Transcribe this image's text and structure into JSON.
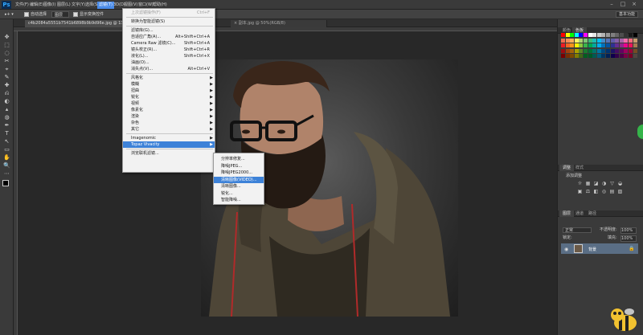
{
  "menubar": {
    "logo": "Ps",
    "items": [
      "文件(F)",
      "编辑(E)",
      "图像(I)",
      "图层(L)",
      "文字(Y)",
      "选择(S)",
      "滤镜(T)",
      "3D(D)",
      "视图(V)",
      "窗口(W)",
      "帮助(H)"
    ],
    "active_index": 6
  },
  "options_bar": {
    "auto_select_label": "自动选择",
    "auto_select_value": "图层",
    "show_transform_label": "显示变换控件",
    "workspace": "基本功能"
  },
  "document_tabs": [
    {
      "label": "c4b2084a5551b7541b6898b9b9d96e.jpg @ 13.5% (RGB/8...",
      "active": true
    },
    {
      "label": "× 副本.jpg @ 50%(RGB/8)",
      "active": false
    }
  ],
  "filter_menu": {
    "items": [
      {
        "label": "上次滤镜操作(F)",
        "shortcut": "Ctrl+F",
        "disabled": true
      },
      {
        "sep": true
      },
      {
        "label": "转换为智能滤镜(S)"
      },
      {
        "sep": true
      },
      {
        "label": "滤镜库(G)..."
      },
      {
        "label": "自适应广角(A)...",
        "shortcut": "Alt+Shift+Ctrl+A"
      },
      {
        "label": "Camera Raw 滤镜(C)...",
        "shortcut": "Shift+Ctrl+A"
      },
      {
        "label": "镜头校正(R)...",
        "shortcut": "Shift+Ctrl+R"
      },
      {
        "label": "液化(L)...",
        "shortcut": "Shift+Ctrl+X"
      },
      {
        "label": "油画(O)..."
      },
      {
        "label": "消失点(V)...",
        "shortcut": "Alt+Ctrl+V"
      },
      {
        "sep": true
      },
      {
        "label": "风格化",
        "submenu": true
      },
      {
        "label": "模糊",
        "submenu": true
      },
      {
        "label": "扭曲",
        "submenu": true
      },
      {
        "label": "锐化",
        "submenu": true
      },
      {
        "label": "视频",
        "submenu": true
      },
      {
        "label": "像素化",
        "submenu": true
      },
      {
        "label": "渲染",
        "submenu": true
      },
      {
        "label": "杂色",
        "submenu": true
      },
      {
        "label": "其它",
        "submenu": true
      },
      {
        "sep": true
      },
      {
        "label": "Imagenomic",
        "submenu": true
      },
      {
        "label": "Topaz Vivacity",
        "submenu": true,
        "highlighted": true
      },
      {
        "sep": true
      },
      {
        "label": "浏览联机滤镜..."
      }
    ]
  },
  "topaz_submenu": {
    "items": [
      {
        "label": "分辨率修复..."
      },
      {
        "label": "降噪JPEG..."
      },
      {
        "label": "降噪JPEG2000..."
      },
      {
        "label": "清晰图像(VIDEO)...",
        "highlighted": true
      },
      {
        "label": "清晰图像..."
      },
      {
        "label": "锐化..."
      },
      {
        "label": "智能降噪..."
      }
    ]
  },
  "panels": {
    "color_tabs": [
      "颜色",
      "色板"
    ],
    "adjust_tabs": [
      "调整",
      "样式"
    ],
    "adjust_add_label": "添加调整",
    "layers_tabs": [
      "图层",
      "通道",
      "路径"
    ],
    "blend_mode": "正常",
    "opacity_label": "不透明度:",
    "opacity_value": "100%",
    "lock_label": "锁定:",
    "fill_label": "填充:",
    "fill_value": "100%",
    "layer_name": "背景"
  },
  "colors": {
    "accent": "#3d82d8",
    "menubar": "#3a3a3a",
    "panel": "#3a3a3a",
    "menu_bg": "#f2f2f2"
  }
}
